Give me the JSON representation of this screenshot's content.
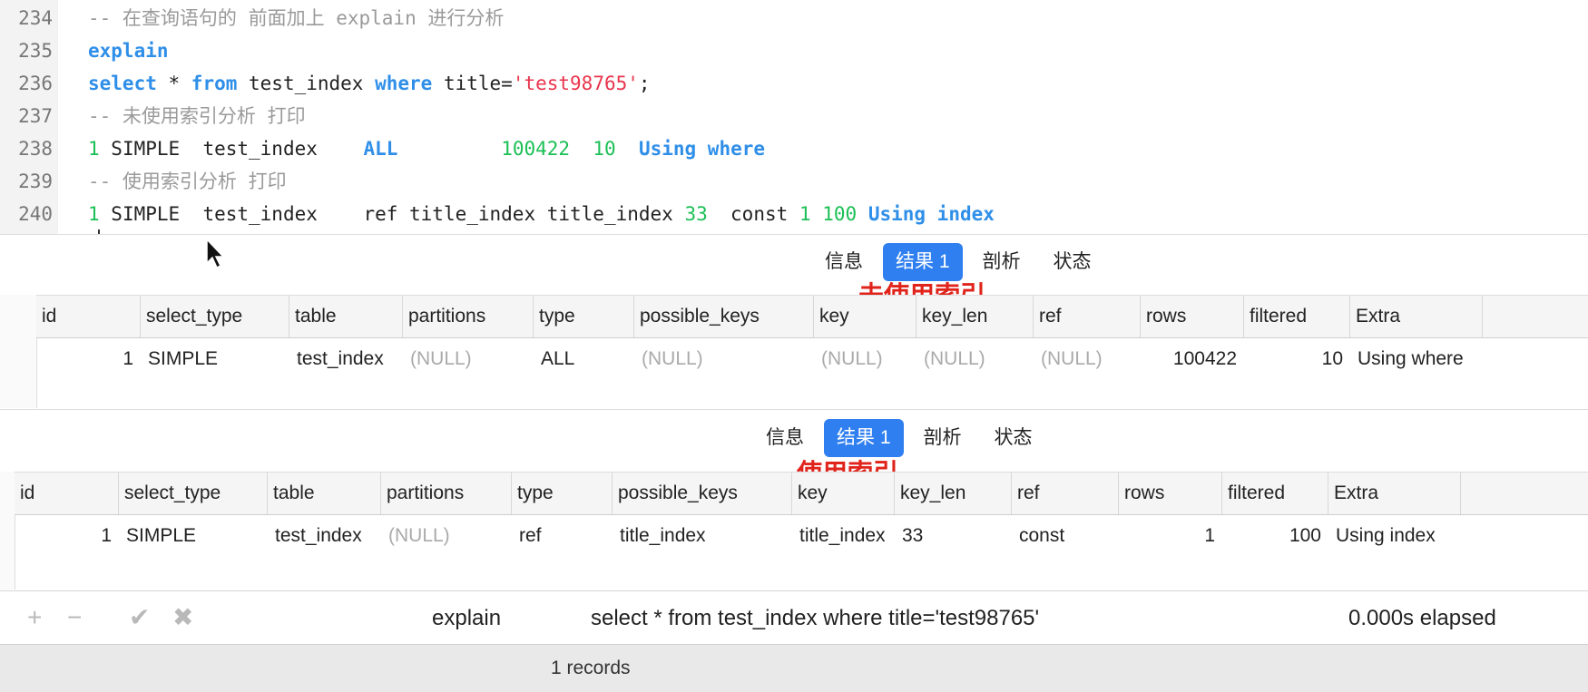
{
  "editor": {
    "lines": [
      {
        "num": "234",
        "parts": [
          {
            "t": "-- 在查询语句的 前面加上 explain 进行分析",
            "c": "cm"
          }
        ]
      },
      {
        "num": "235",
        "parts": [
          {
            "t": "explain",
            "c": "kw"
          }
        ]
      },
      {
        "num": "236",
        "parts": [
          {
            "t": "select",
            "c": "kw"
          },
          {
            "t": " * ",
            "c": ""
          },
          {
            "t": "from",
            "c": "kw"
          },
          {
            "t": " test_index ",
            "c": ""
          },
          {
            "t": "where",
            "c": "kw"
          },
          {
            "t": " title=",
            "c": ""
          },
          {
            "t": "'test98765'",
            "c": "str"
          },
          {
            "t": ";",
            "c": ""
          }
        ]
      },
      {
        "num": "237",
        "parts": [
          {
            "t": "-- 未使用索引分析 打印",
            "c": "cm"
          }
        ]
      },
      {
        "num": "238",
        "parts": [
          {
            "t": "1",
            "c": "num"
          },
          {
            "t": " SIMPLE  test_index    ",
            "c": ""
          },
          {
            "t": "ALL",
            "c": "kw"
          },
          {
            "t": "         ",
            "c": ""
          },
          {
            "t": "100422",
            "c": "num"
          },
          {
            "t": "  ",
            "c": ""
          },
          {
            "t": "10",
            "c": "num"
          },
          {
            "t": "  ",
            "c": ""
          },
          {
            "t": "Using where",
            "c": "kw"
          }
        ]
      },
      {
        "num": "239",
        "parts": [
          {
            "t": "-- 使用索引分析 打印",
            "c": "cm"
          }
        ]
      },
      {
        "num": "240",
        "parts": [
          {
            "t": "1",
            "c": "num"
          },
          {
            "t": " SIMPLE  test_index    ref title_index title_index ",
            "c": ""
          },
          {
            "t": "33",
            "c": "num"
          },
          {
            "t": "  const ",
            "c": ""
          },
          {
            "t": "1",
            "c": "num"
          },
          {
            "t": " ",
            "c": ""
          },
          {
            "t": "100",
            "c": "num"
          },
          {
            "t": " ",
            "c": ""
          },
          {
            "t": "Using index",
            "c": "kw"
          }
        ]
      }
    ]
  },
  "tabs": {
    "info": "信息",
    "result": "结果 1",
    "profile": "剖析",
    "status": "状态"
  },
  "annotations": {
    "no_index": "未使用索引",
    "with_index": "使用索引"
  },
  "columns": [
    "id",
    "select_type",
    "table",
    "partitions",
    "type",
    "possible_keys",
    "key",
    "key_len",
    "ref",
    "rows",
    "filtered",
    "Extra"
  ],
  "result1": {
    "row": [
      "1",
      "SIMPLE",
      "test_index",
      "(NULL)",
      "ALL",
      "(NULL)",
      "(NULL)",
      "(NULL)",
      "(NULL)",
      "100422",
      "10",
      "Using where"
    ]
  },
  "result2": {
    "row": [
      "1",
      "SIMPLE",
      "test_index",
      "(NULL)",
      "ref",
      "title_index",
      "title_index",
      "33",
      "const",
      "1",
      "100",
      "Using index"
    ]
  },
  "toolbar": {
    "add_icon": "plus-icon",
    "remove_icon": "minus-icon",
    "apply_icon": "check-icon",
    "discard_icon": "x-icon",
    "query_label": "explain",
    "query_text": "select * from test_index where title='test98765'",
    "elapsed": "0.000s elapsed"
  },
  "statusbar": {
    "records": "1 records"
  }
}
